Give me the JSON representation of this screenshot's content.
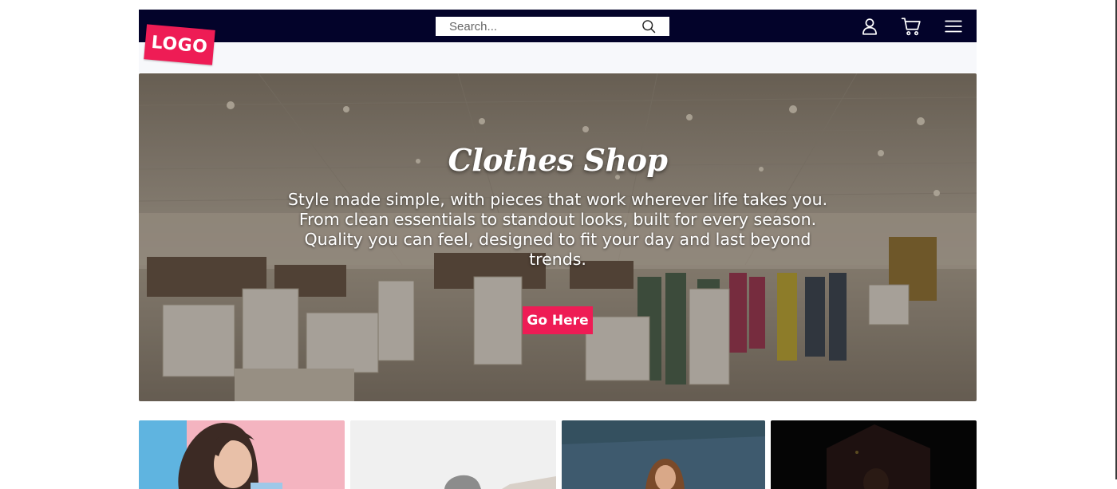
{
  "header": {
    "logo_text": "LOGO",
    "search": {
      "placeholder": "Search..."
    },
    "icons": [
      "search-icon",
      "user-icon",
      "cart-icon",
      "menu-icon"
    ]
  },
  "hero": {
    "title": "Clothes Shop",
    "description_lines": [
      "Style made simple, with pieces that work wherever life takes you.",
      "From clean essentials to standout looks, built for every season.",
      "Quality you can feel, designed to fit your day and last beyond",
      "trends."
    ],
    "cta_label": "Go Here"
  },
  "colors": {
    "topbar": "#03032a",
    "accent": "#ee1c55",
    "subbar": "#f7f8fb"
  },
  "product_cards": [
    {
      "image": "woman-pink-blue-backdrop"
    },
    {
      "image": "model-light-grey-backdrop"
    },
    {
      "image": "woman-dark-teal-wall"
    },
    {
      "image": "person-dark-backdrop"
    }
  ]
}
